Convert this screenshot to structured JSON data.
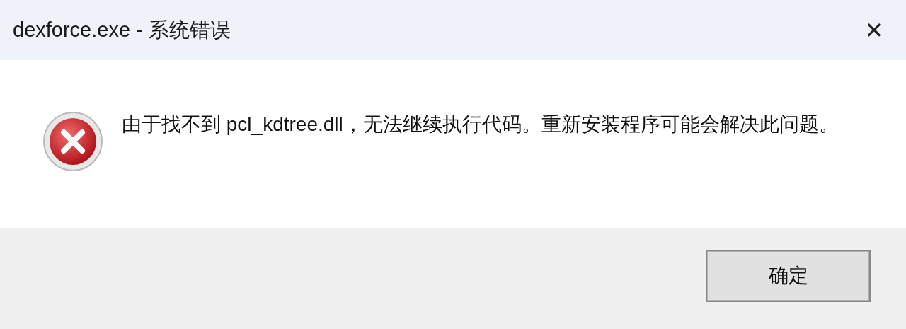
{
  "window": {
    "title": "dexforce.exe - 系统错误",
    "close": "✕"
  },
  "message": {
    "kind": "error",
    "text": "由于找不到 pcl_kdtree.dll，无法继续执行代码。重新安装程序可能会解决此问题。"
  },
  "buttons": [
    {
      "label": "确定",
      "default": true
    }
  ]
}
